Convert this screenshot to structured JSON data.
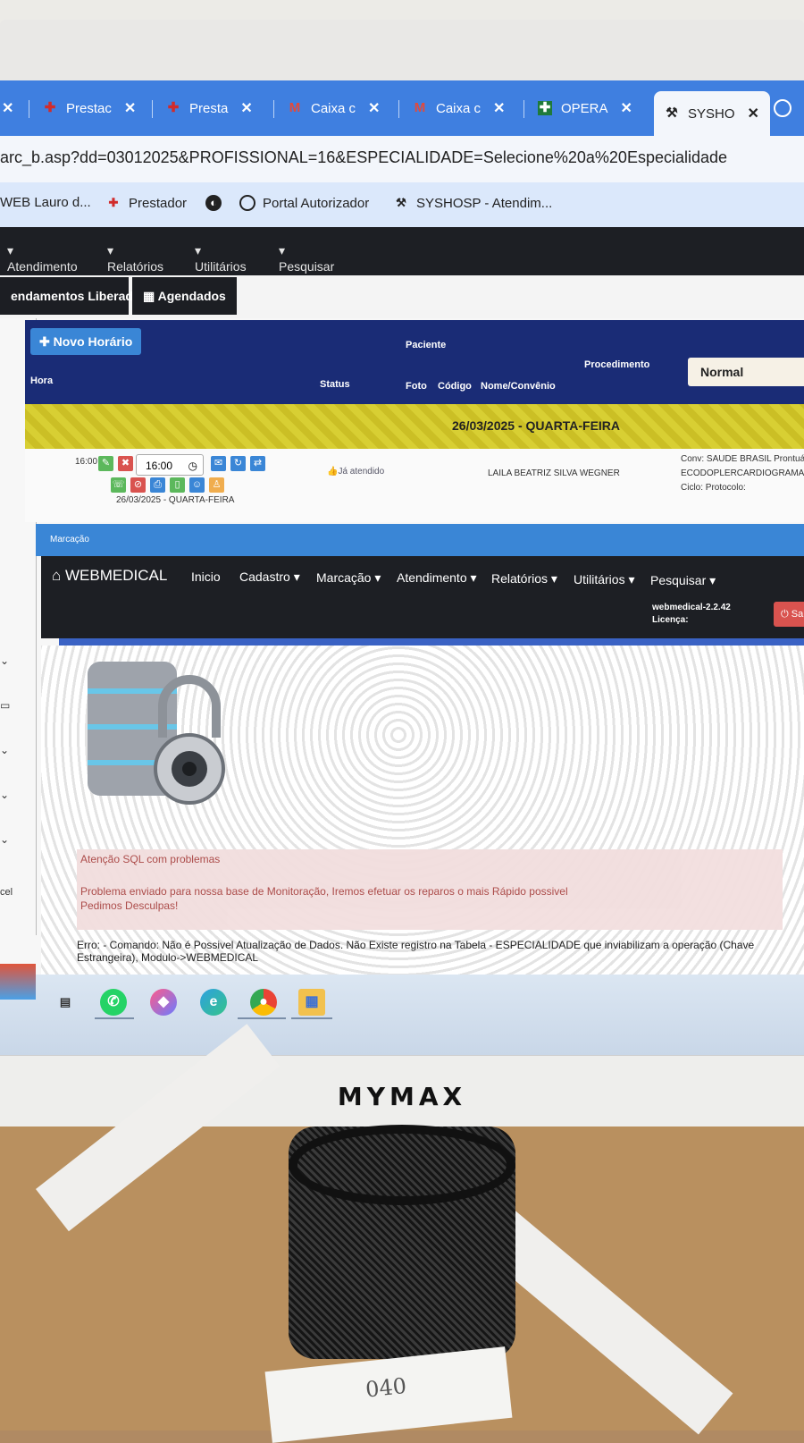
{
  "browser": {
    "tabs": [
      {
        "icon": "close-icon",
        "label": ""
      },
      {
        "icon": "red-cross-icon",
        "label": "Prestac"
      },
      {
        "icon": "red-cross-icon",
        "label": "Presta"
      },
      {
        "icon": "gmail-icon",
        "label": "Caixa c"
      },
      {
        "icon": "gmail-icon",
        "label": "Caixa c"
      },
      {
        "icon": "green-cross-icon",
        "label": "OPERA"
      },
      {
        "icon": "tools-icon",
        "label": "SYSHO"
      }
    ],
    "address": "arc_b.asp?dd=03012025&PROFISSIONAL=16&ESPECIALIDADE=Selecione%20a%20Especialidade",
    "bookmarks": [
      "WEB Lauro d...",
      "Prestador",
      "",
      "Portal Autorizador",
      "SYSHOSP - Atendim..."
    ]
  },
  "top_nav": [
    "Atendimento",
    "Relatórios",
    "Utilitários",
    "Pesquisar"
  ],
  "subtabs": [
    "endamentos Liberados",
    "Agendados"
  ],
  "schedule": {
    "new_button": "Novo Horário",
    "headers": {
      "hora": "Hora",
      "status": "Status",
      "paciente": "Paciente",
      "foto": "Foto",
      "codigo": "Código",
      "nome": "Nome/Convênio",
      "procedimento": "Procedimento"
    },
    "mode_select": "Normal",
    "date_band": "26/03/2025 - QUARTA-FEIRA",
    "row": {
      "time_label": "16:00",
      "time_input": "16:00",
      "date": "26/03/2025 - QUARTA-FEIRA",
      "status": "Já atendido",
      "patient": "LAILA BEATRIZ SILVA WEGNER",
      "conv": "Conv: SAUDE BRASIL Prontuá",
      "procedure": "ECODOPLERCARDIOGRAMA T",
      "ciclo": "Ciclo: Protocolo:"
    }
  },
  "marcacao": {
    "title": "Marcação",
    "brand": "WEBMEDICAL",
    "menu": [
      "Inicio",
      "Cadastro",
      "Marcação",
      "Atendimento",
      "Relatórios",
      "Utilitários",
      "Pesquisar"
    ],
    "version": "webmedical-2.2.42",
    "license": "Licença:",
    "sair": "Sa"
  },
  "error": {
    "alert_title": "Atenção SQL com problemas",
    "alert_line1": "Problema enviado para nossa base de Monitoração, Iremos efetuar os reparos o mais Rápido possivel",
    "alert_line2": "Pedimos Desculpas!",
    "message": "Erro: - Comando: Não é Possivel Atualização de Dados. Não Existe registro na Tabela - ESPECIALIDADE que inviabilizam a operação (Chave Estrangeira), Modulo->WEBMEDICAL"
  },
  "sidebar_fragment": "cel",
  "monitor_brand": "MYMAX",
  "paper_note": "040",
  "taskbar_icons": [
    "whatsapp-icon",
    "copilot-icon",
    "edge-icon",
    "chrome-icon",
    "files-icon"
  ]
}
